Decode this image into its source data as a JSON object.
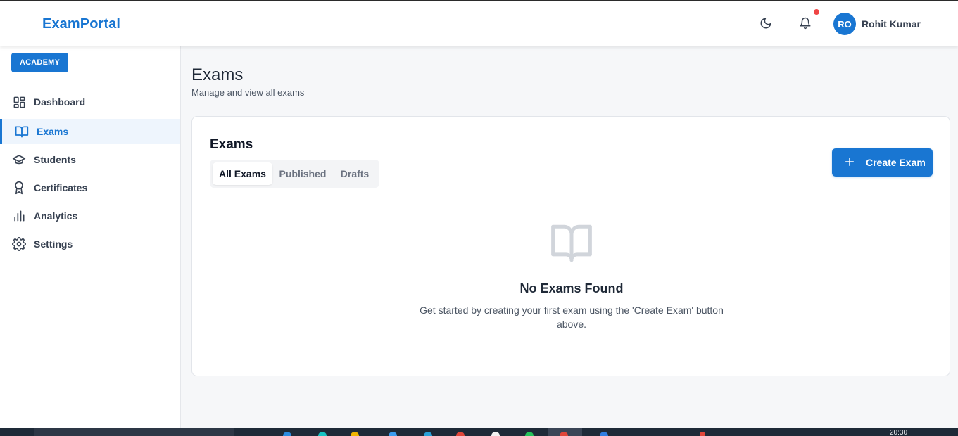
{
  "header": {
    "brand": "ExamPortal",
    "user_initials": "RO",
    "user_name": "Rohit Kumar",
    "icons": [
      "moon-icon",
      "bell-icon"
    ]
  },
  "sidebar": {
    "org_badge": "ACADEMY",
    "items": [
      {
        "label": "Dashboard",
        "icon": "dashboard-icon",
        "active": false
      },
      {
        "label": "Exams",
        "icon": "book-icon",
        "active": true
      },
      {
        "label": "Students",
        "icon": "graduation-cap-icon",
        "active": false
      },
      {
        "label": "Certificates",
        "icon": "award-icon",
        "active": false
      },
      {
        "label": "Analytics",
        "icon": "bar-chart-icon",
        "active": false
      },
      {
        "label": "Settings",
        "icon": "gear-icon",
        "active": false
      }
    ]
  },
  "main": {
    "title": "Exams",
    "subtitle": "Manage and view all exams",
    "card": {
      "title": "Exams",
      "tabs": [
        {
          "label": "All Exams",
          "active": true
        },
        {
          "label": "Published",
          "active": false
        },
        {
          "label": "Drafts",
          "active": false
        }
      ],
      "create_button": "Create Exam",
      "empty_state": {
        "title": "No Exams Found",
        "description": "Get started by creating your first exam using the 'Create Exam' button above."
      }
    }
  },
  "taskbar": {
    "clock": "20:30"
  },
  "colors": {
    "accent": "#1976d2",
    "notification": "#ef4444",
    "background": "#f6f7f9"
  }
}
